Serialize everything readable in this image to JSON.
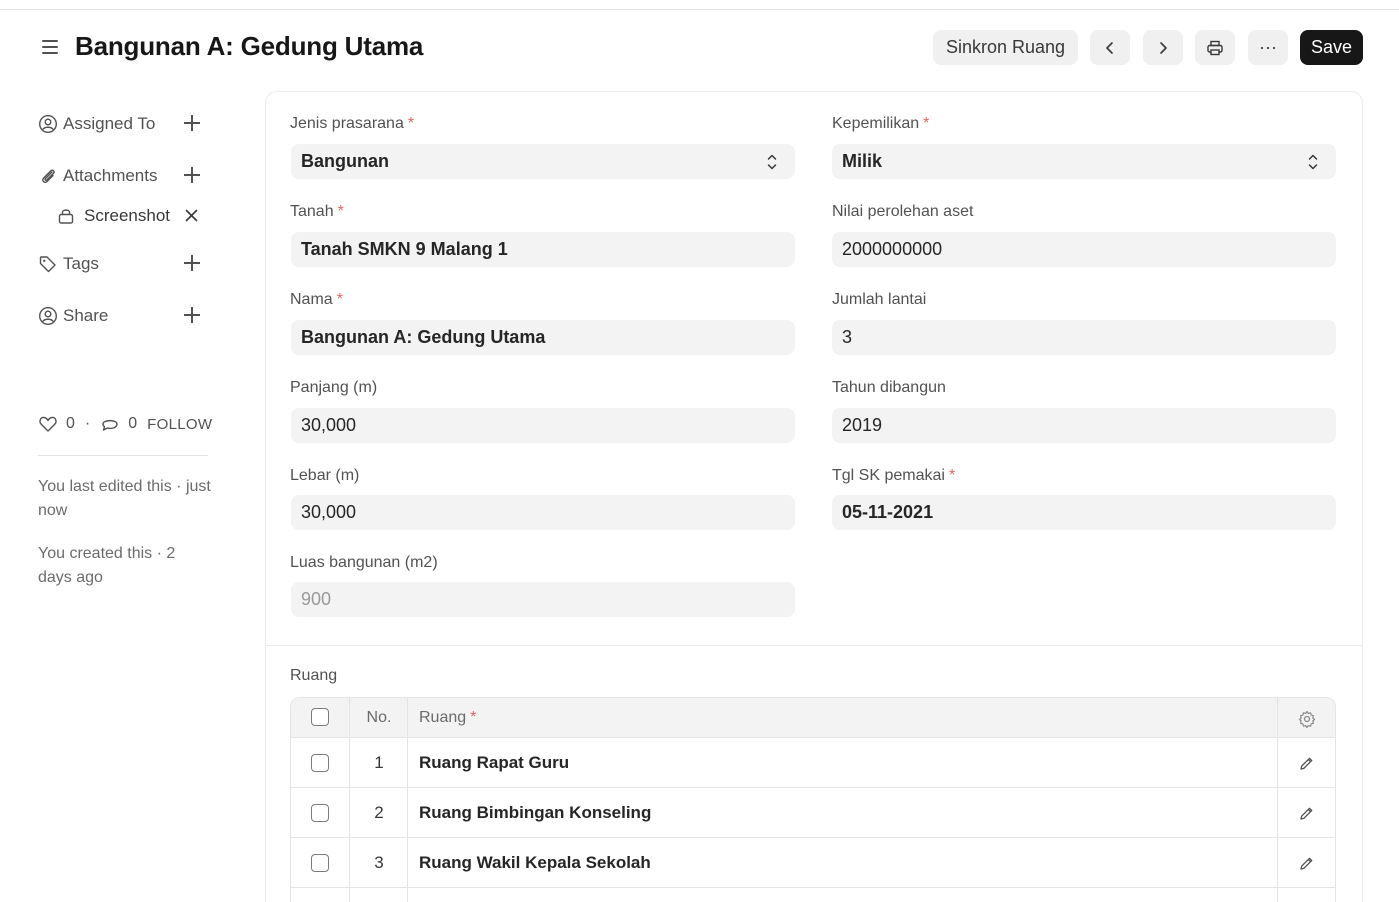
{
  "header": {
    "title": "Bangunan A: Gedung Utama",
    "sync_button": "Sinkron Ruang",
    "more_label": "···",
    "save_button": "Save"
  },
  "sidebar": {
    "assigned_to": "Assigned To",
    "attachments": "Attachments",
    "attachment_items": [
      "Screenshot"
    ],
    "tags": "Tags",
    "share": "Share",
    "likes": "0",
    "separator": "·",
    "comments": "0",
    "follow": "FOLLOW",
    "last_edited": "You last edited this · just now",
    "created": "You created this · 2 days ago"
  },
  "form": {
    "jenis_prasarana": {
      "label": "Jenis prasarana",
      "required": "*",
      "value": "Bangunan"
    },
    "kepemilikan": {
      "label": "Kepemilikan",
      "required": "*",
      "value": "Milik"
    },
    "tanah": {
      "label": "Tanah",
      "required": "*",
      "value": "Tanah SMKN 9 Malang 1"
    },
    "nilai_perolehan": {
      "label": "Nilai perolehan aset",
      "value": "2000000000"
    },
    "nama": {
      "label": "Nama",
      "required": "*",
      "value": "Bangunan A: Gedung Utama"
    },
    "jumlah_lantai": {
      "label": "Jumlah lantai",
      "value": "3"
    },
    "panjang": {
      "label": "Panjang (m)",
      "value": "30,000"
    },
    "tahun_dibangun": {
      "label": "Tahun dibangun",
      "value": "2019"
    },
    "lebar": {
      "label": "Lebar (m)",
      "value": "30,000"
    },
    "tgl_sk": {
      "label": "Tgl SK pemakai",
      "required": "*",
      "value": "05-11-2021"
    },
    "luas": {
      "label": "Luas bangunan (m2)",
      "value": "900"
    }
  },
  "ruang_table": {
    "section_label": "Ruang",
    "col_no": "No.",
    "col_ruang": "Ruang",
    "col_ruang_required": "*",
    "rows": [
      {
        "no": "1",
        "ruang": "Ruang Rapat Guru"
      },
      {
        "no": "2",
        "ruang": "Ruang Bimbingan Konseling"
      },
      {
        "no": "3",
        "ruang": "Ruang Wakil Kepala Sekolah"
      }
    ]
  },
  "colors": {
    "primary_button": "#171717",
    "input_bg": "#f3f3f3",
    "required_mark": "#e26565"
  }
}
